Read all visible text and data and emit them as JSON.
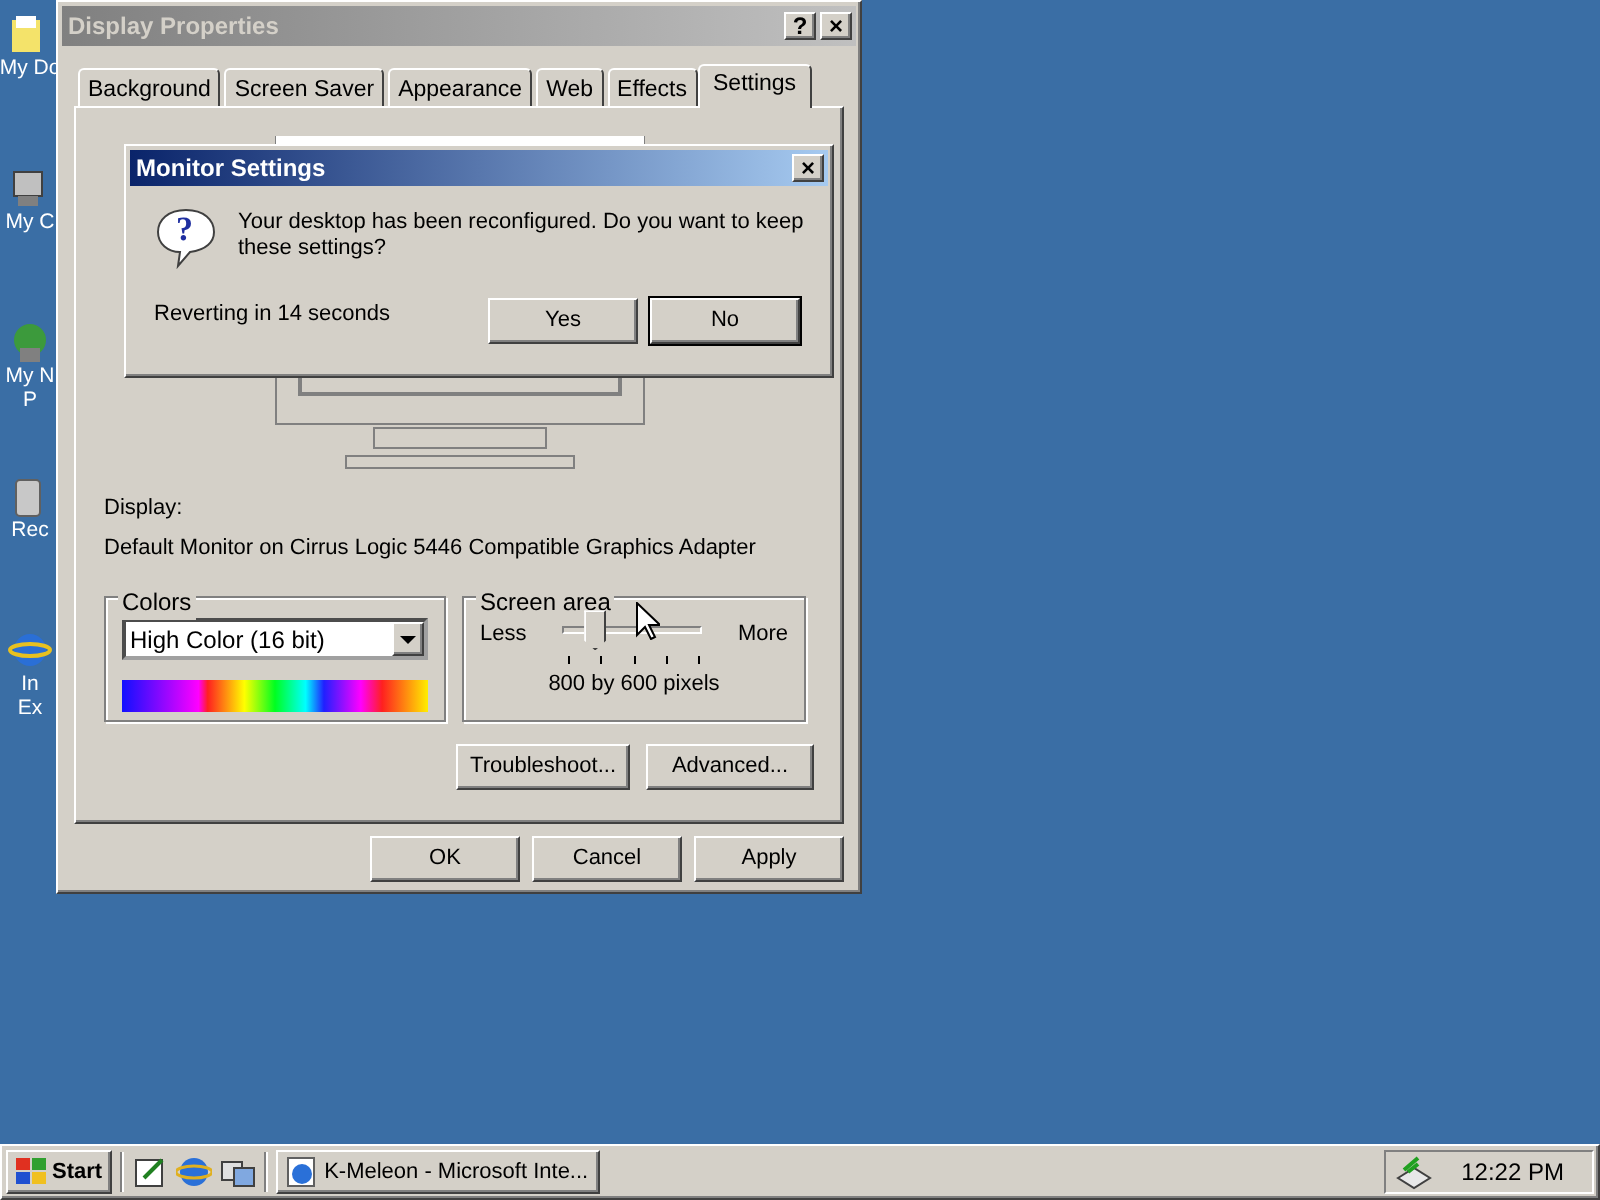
{
  "desktop": {
    "icons": [
      {
        "lines": [
          "My Do"
        ]
      },
      {
        "lines": [
          "My C"
        ]
      },
      {
        "lines": [
          "My N",
          "P"
        ]
      },
      {
        "lines": [
          "Rec"
        ]
      },
      {
        "lines": [
          "In",
          "Ex"
        ]
      }
    ]
  },
  "display_properties": {
    "title": "Display Properties",
    "title_buttons": [
      "?",
      "×"
    ],
    "tabs": [
      {
        "label": "Background",
        "selected": false
      },
      {
        "label": "Screen Saver",
        "selected": false
      },
      {
        "label": "Appearance",
        "selected": false
      },
      {
        "label": "Web",
        "selected": false
      },
      {
        "label": "Effects",
        "selected": false
      },
      {
        "label": "Settings",
        "selected": true
      }
    ],
    "display_label": "Display:",
    "display_value": "Default Monitor on Cirrus Logic 5446 Compatible Graphics Adapter",
    "colors": {
      "legend": "Colors",
      "value": "High Color (16 bit)"
    },
    "screen_area": {
      "legend": "Screen area",
      "less": "Less",
      "more": "More",
      "level": 0.25,
      "reading": "800 by 600 pixels"
    },
    "buttons": [
      "Troubleshoot...",
      "Advanced..."
    ],
    "footer_buttons": [
      "OK",
      "Cancel",
      "Apply"
    ]
  },
  "monitor_dialog": {
    "title": "Monitor Settings",
    "close": "×",
    "icon_glyph": "?",
    "message": "Your desktop has been reconfigured.  Do you want to keep these settings?",
    "countdown": "Reverting in 14 seconds",
    "buttons": [
      {
        "label": "Yes",
        "default": false
      },
      {
        "label": "No",
        "default": true
      }
    ]
  },
  "taskbar": {
    "start": "Start",
    "tasks": [
      {
        "label": "K-Meleon - Microsoft Inte...",
        "selected": false
      }
    ],
    "clock": "12:22 PM"
  }
}
